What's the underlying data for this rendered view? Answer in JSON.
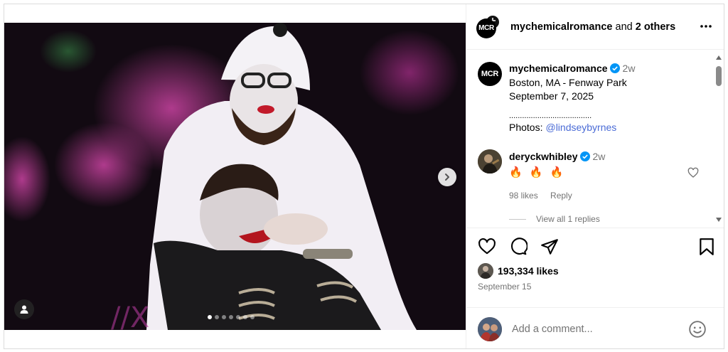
{
  "header": {
    "username": "mychemicalromance",
    "and_text": "and",
    "others_text": "2 others",
    "avatar_text": "MCR"
  },
  "caption": {
    "avatar_text": "MCR",
    "username": "mychemicalromance",
    "time": "2w",
    "line1": "Boston, MA - Fenway Park",
    "line2": "September 7, 2025",
    "divider": "......................................",
    "photos_label": "Photos:",
    "mention": "@lindseybyrnes"
  },
  "comment": {
    "username": "deryckwhibley",
    "time": "2w",
    "text": "🔥 🔥 🔥",
    "likes": "98 likes",
    "reply": "Reply",
    "view_replies": "View all 1 replies"
  },
  "post": {
    "likes": "193,334 likes",
    "date": "September 15"
  },
  "add_comment": {
    "placeholder": "Add a comment..."
  },
  "carousel": {
    "total": 7,
    "active_index": 0
  },
  "colors": {
    "verified": "#0095f6",
    "mention": "#4a6bd6",
    "muted": "#737373"
  }
}
